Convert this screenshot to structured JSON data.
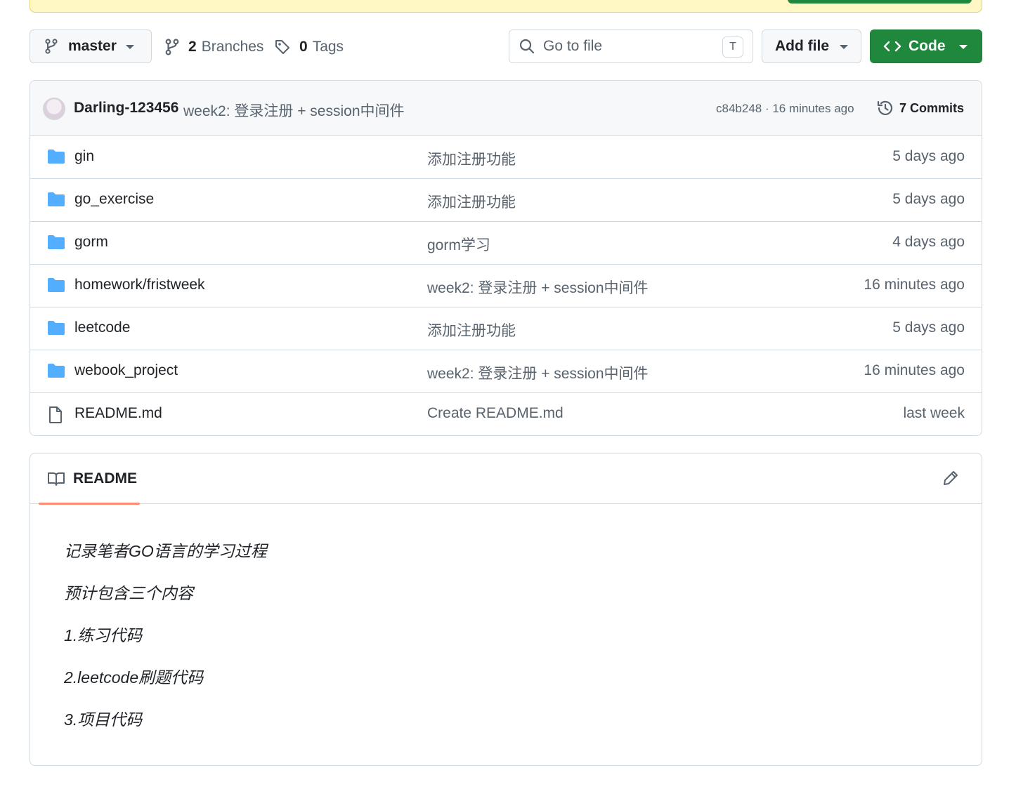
{
  "toolbar": {
    "branch": "master",
    "branches_count": "2",
    "branches_label": "Branches",
    "tags_count": "0",
    "tags_label": "Tags",
    "search_placeholder": "Go to file",
    "search_shortcut": "T",
    "add_file_label": "Add file",
    "code_label": "Code"
  },
  "latest_commit": {
    "author": "Darling-123456",
    "message": "week2: 登录注册 + session中间件",
    "info": "c84b248 · 16 minutes ago",
    "commits_label": "7 Commits"
  },
  "files": [
    {
      "type": "folder",
      "name": "gin",
      "message": "添加注册功能",
      "age": "5 days ago"
    },
    {
      "type": "folder",
      "name": "go_exercise",
      "message": "添加注册功能",
      "age": "5 days ago"
    },
    {
      "type": "folder",
      "name": "gorm",
      "message": "gorm学习",
      "age": "4 days ago"
    },
    {
      "type": "folder",
      "name": "homework/fristweek",
      "message": "week2: 登录注册 + session中间件",
      "age": "16 minutes ago"
    },
    {
      "type": "folder",
      "name": "leetcode",
      "message": "添加注册功能",
      "age": "5 days ago"
    },
    {
      "type": "folder",
      "name": "webook_project",
      "message": "week2: 登录注册 + session中间件",
      "age": "16 minutes ago"
    },
    {
      "type": "file",
      "name": "README.md",
      "message": "Create README.md",
      "age": "last week"
    }
  ],
  "readme": {
    "tab_label": "README",
    "lines": [
      "记录笔者GO语言的学习过程",
      "预计包含三个内容",
      "1.练习代码",
      "2.leetcode刷题代码",
      "3.项目代码"
    ]
  },
  "colors": {
    "primary_green": "#1f883d",
    "folder_blue": "#54aeff",
    "tab_underline": "#fd8c73",
    "banner_yellow": "#fff8c5"
  },
  "icons": {
    "branch": "git-branch-icon",
    "tag": "tag-icon",
    "search": "search-icon",
    "code": "code-icon",
    "history": "history-icon",
    "folder": "folder-icon",
    "file": "file-icon",
    "book": "book-icon",
    "edit": "pencil-icon"
  }
}
